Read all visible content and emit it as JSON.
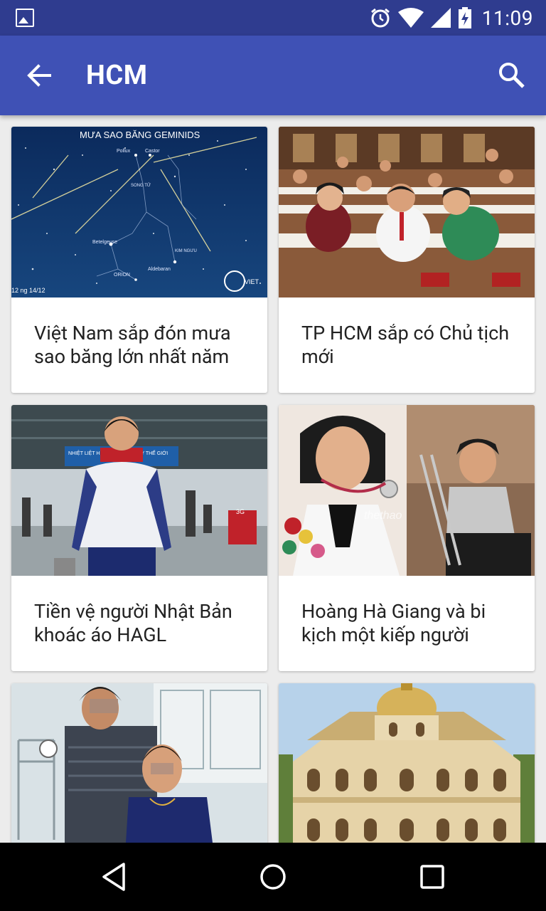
{
  "status": {
    "time": "11:09"
  },
  "app_bar": {
    "title": "HCM"
  },
  "articles": [
    {
      "title": "Việt Nam sắp đón mưa sao băng lớn nhất năm",
      "image_texts": {
        "heading": "MƯA SAO BĂNG GEMINIDS",
        "pollux": "Pollux",
        "castor": "Castor",
        "song_tu": "SONG TỬ",
        "betelgeuse": "Betelgeuse",
        "kim_nguu": "KIM NGƯU",
        "aldebaran": "Aldebaran",
        "orion": "ORION",
        "date": "12 ng 14/12",
        "brand": "VIET"
      }
    },
    {
      "title": "TP HCM sắp có Chủ tịch mới"
    },
    {
      "title": "Tiền vệ người Nhật Bản khoác áo HAGL",
      "image_texts": {
        "banner": "NHIỆT LIỆT HƯỞNG ỨNG NGÀY THẾ GIỚI",
        "sign": "3G"
      }
    },
    {
      "title": "Hoàng Hà Giang và bi kịch một kiếp người",
      "image_texts": {
        "watermark": "thethao"
      }
    },
    {
      "title": ""
    },
    {
      "title": ""
    }
  ],
  "colors": {
    "status_bar": "#2f3c8f",
    "app_bar": "#3f51b5",
    "background": "#ececec"
  },
  "icons": {
    "back": "arrow-left-icon",
    "search": "search-icon",
    "alarm": "alarm-icon",
    "wifi": "wifi-icon",
    "signal": "signal-icon",
    "battery": "battery-icon",
    "gallery": "gallery-icon",
    "nav_back": "nav-back-icon",
    "nav_home": "nav-home-icon",
    "nav_recent": "nav-recent-icon"
  }
}
